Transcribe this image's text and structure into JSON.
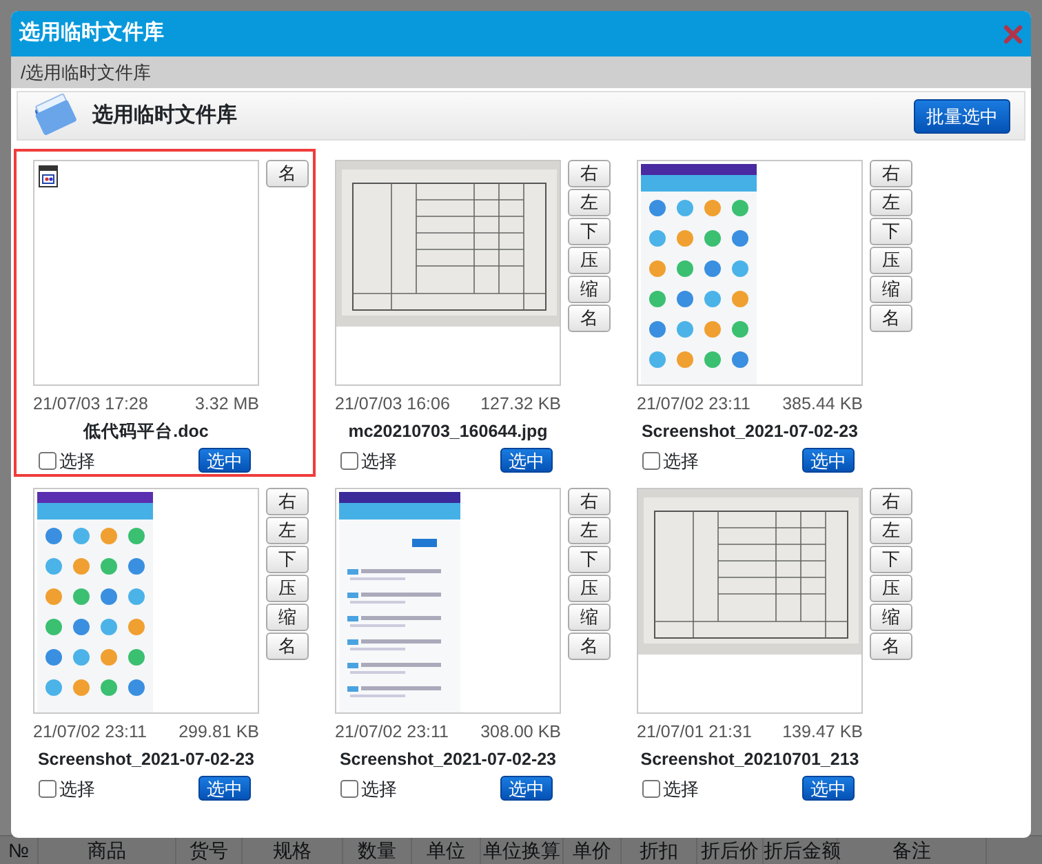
{
  "background": {
    "table_columns": [
      "№",
      "商品",
      "货号",
      "规格",
      "数量",
      "单位",
      "单位换算",
      "单价",
      "折扣",
      "折后价",
      "折后金额",
      "备注"
    ]
  },
  "dialog": {
    "title": "选用临时文件库",
    "breadcrumb": "/选用临时文件库",
    "heading": "选用临时文件库",
    "batch_button": "批量选中"
  },
  "files": [
    {
      "kind": "doc",
      "date": "21/07/03 17:28",
      "size": "3.32 MB",
      "name": "低代码平台.doc",
      "selected": true,
      "checked": false,
      "check_label": "选择",
      "select_button": "选中",
      "actions": [
        "名"
      ]
    },
    {
      "kind": "picture",
      "date": "21/07/03 16:06",
      "size": "127.32 KB",
      "name": "mc20210703_160644.jpg",
      "selected": false,
      "checked": false,
      "check_label": "选择",
      "select_button": "选中",
      "actions": [
        "右",
        "左",
        "下",
        "压",
        "缩",
        "名"
      ]
    },
    {
      "kind": "picture",
      "date": "21/07/02 23:11",
      "size": "385.44 KB",
      "name": "Screenshot_2021-07-02-23",
      "selected": false,
      "checked": false,
      "check_label": "选择",
      "select_button": "选中",
      "actions": [
        "右",
        "左",
        "下",
        "压",
        "缩",
        "名"
      ]
    },
    {
      "kind": "picture",
      "date": "21/07/02 23:11",
      "size": "299.81 KB",
      "name": "Screenshot_2021-07-02-23",
      "selected": false,
      "checked": false,
      "check_label": "选择",
      "select_button": "选中",
      "actions": [
        "右",
        "左",
        "下",
        "压",
        "缩",
        "名"
      ]
    },
    {
      "kind": "picture",
      "date": "21/07/02 23:11",
      "size": "308.00 KB",
      "name": "Screenshot_2021-07-02-23",
      "selected": false,
      "checked": false,
      "check_label": "选择",
      "select_button": "选中",
      "actions": [
        "右",
        "左",
        "下",
        "压",
        "缩",
        "名"
      ]
    },
    {
      "kind": "picture",
      "date": "21/07/01 21:31",
      "size": "139.47 KB",
      "name": "Screenshot_20210701_213",
      "selected": false,
      "checked": false,
      "check_label": "选择",
      "select_button": "选中",
      "actions": [
        "右",
        "左",
        "下",
        "压",
        "缩",
        "名"
      ]
    }
  ]
}
